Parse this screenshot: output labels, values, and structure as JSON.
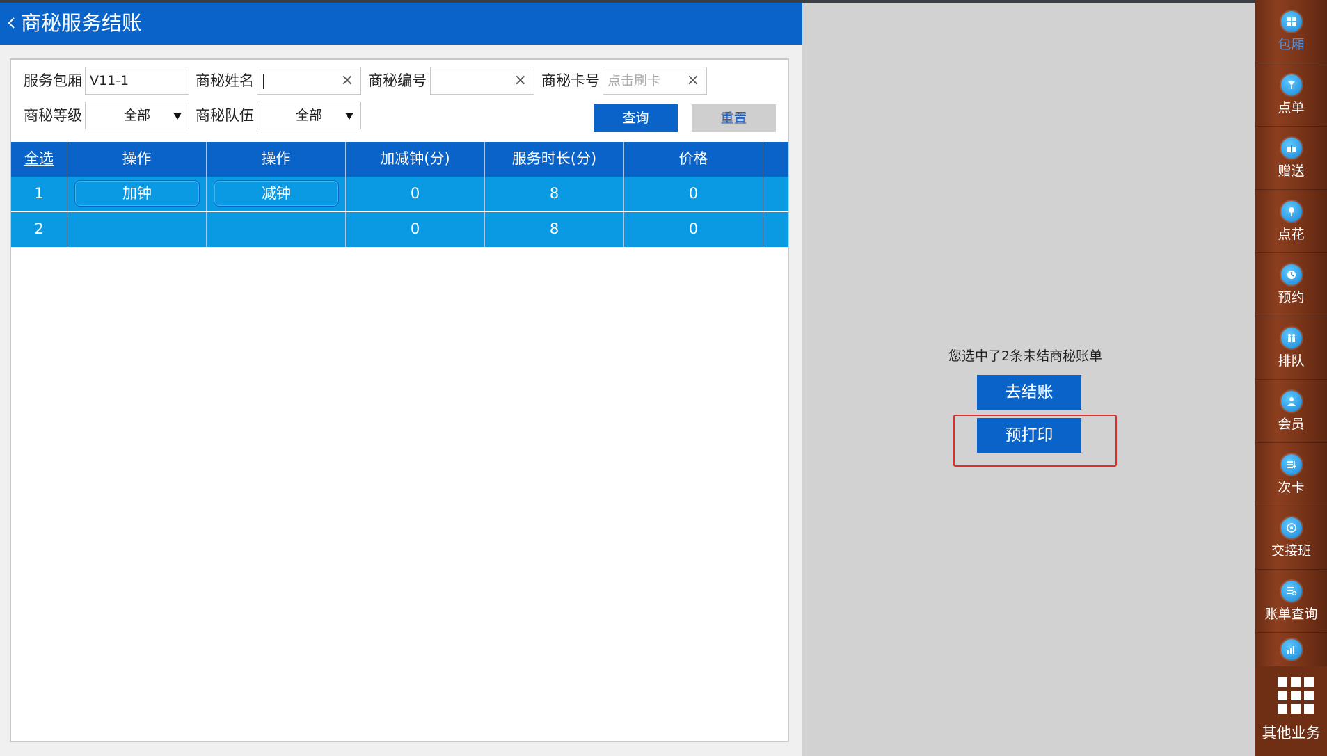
{
  "header": {
    "title": "商秘服务结账"
  },
  "filters": {
    "room_label": "服务包厢",
    "room_value": "V11-1",
    "name_label": "商秘姓名",
    "name_value": "",
    "number_label": "商秘编号",
    "number_value": "",
    "card_label": "商秘卡号",
    "card_placeholder": "点击刷卡",
    "clear_glyph": "×",
    "level_label": "商秘等级",
    "level_value": "全部",
    "team_label": "商秘队伍",
    "team_value": "全部",
    "query_label": "查询",
    "reset_label": "重置"
  },
  "table": {
    "headers": [
      "全选",
      "操作",
      "操作",
      "加减钟(分)",
      "服务时长(分)",
      "价格"
    ],
    "rows": [
      {
        "index": "1",
        "add_label": "加钟",
        "sub_label": "减钟",
        "delta": "0",
        "duration": "8",
        "price": "0"
      },
      {
        "index": "2",
        "add_label": "",
        "sub_label": "",
        "delta": "0",
        "duration": "8",
        "price": "0"
      }
    ]
  },
  "summary": {
    "text": "您选中了2条未结商秘账单",
    "checkout_label": "去结账",
    "preprint_label": "预打印",
    "highlight_color": "#e12b2b"
  },
  "sidebar": {
    "items": [
      {
        "label": "包厢",
        "icon": "rooms-icon"
      },
      {
        "label": "点单",
        "icon": "order-icon"
      },
      {
        "label": "赠送",
        "icon": "gift-icon"
      },
      {
        "label": "点花",
        "icon": "flower-icon"
      },
      {
        "label": "预约",
        "icon": "reservation-icon"
      },
      {
        "label": "排队",
        "icon": "queue-icon"
      },
      {
        "label": "会员",
        "icon": "member-icon"
      },
      {
        "label": "次卡",
        "icon": "punch-card-icon"
      },
      {
        "label": "交接班",
        "icon": "shift-handover-icon"
      },
      {
        "label": "账单查询",
        "icon": "bill-query-icon"
      },
      {
        "label": "",
        "icon": "report-icon"
      }
    ],
    "more_label": "其他业务"
  },
  "colors": {
    "primary": "#0a63c9",
    "row_fill": "#0a9ae4",
    "sidebar_wood": "#7b3519"
  }
}
